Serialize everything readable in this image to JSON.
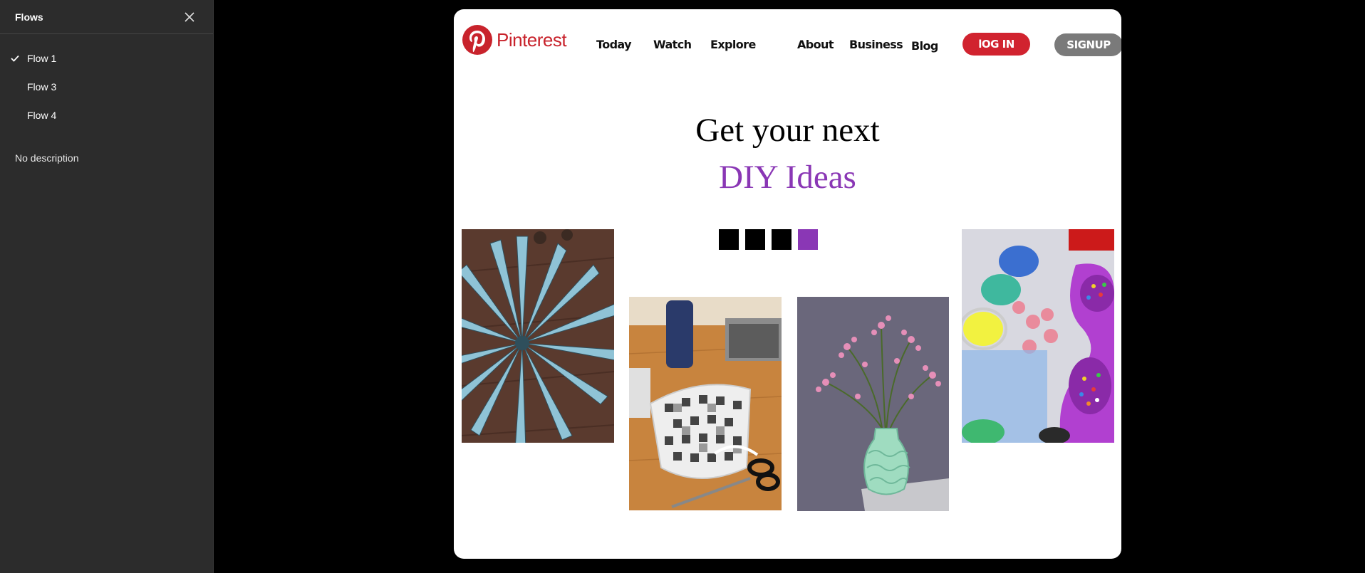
{
  "sidebar": {
    "title": "Flows",
    "flows": [
      {
        "label": "Flow 1",
        "selected": true
      },
      {
        "label": "Flow 3",
        "selected": false
      },
      {
        "label": "Flow 4",
        "selected": false
      }
    ],
    "description": "No description"
  },
  "site": {
    "logo_text": "Pinterest",
    "nav": {
      "today": "Today",
      "watch": "Watch",
      "explore": "Explore",
      "about": "About",
      "business": "Business",
      "blog": "Blog"
    },
    "login_label": "lOG IN",
    "signup_label": "SIGNUP",
    "headline": "Get your next",
    "subheadline": "DIY Ideas",
    "carousel_active_index": 4,
    "carousel_count": 4
  },
  "colors": {
    "brand_red": "#c8232c",
    "accent_purple": "#8a37b5",
    "signup_gray": "#7a7a7a"
  }
}
